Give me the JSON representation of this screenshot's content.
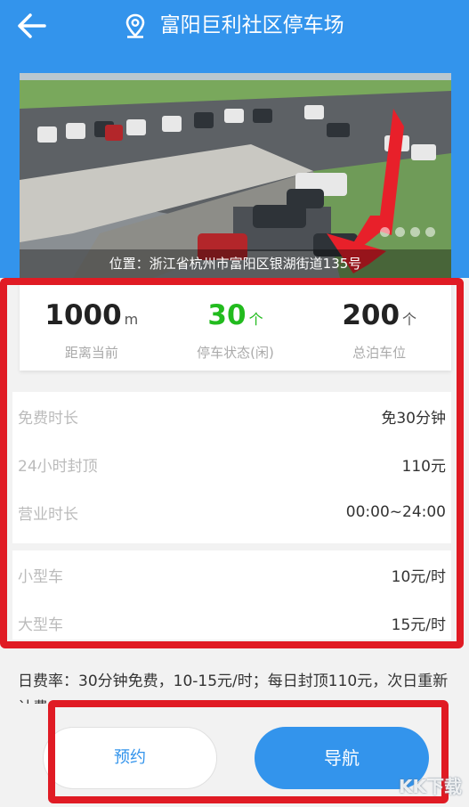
{
  "header": {
    "title": "富阳巨利社区停车场"
  },
  "photo": {
    "address": "位置：浙江省杭州市富阳区银湖街道135号"
  },
  "stats": [
    {
      "value": "1000",
      "unit": "m",
      "label": "距离当前"
    },
    {
      "value": "30",
      "unit": "个",
      "label": "停车状态(闲)"
    },
    {
      "value": "200",
      "unit": "个",
      "label": "总泊车位"
    }
  ],
  "info_a": [
    {
      "key": "免费时长",
      "value": "免30分钟"
    },
    {
      "key": "24小时封顶",
      "value": "110元"
    },
    {
      "key": "营业时长",
      "value": "00:00~24:00"
    }
  ],
  "info_b": [
    {
      "key": "小型车",
      "value": "10元/时"
    },
    {
      "key": "大型车",
      "value": "15元/时"
    }
  ],
  "fee_note": "日费率：30分钟免费，10-15元/时；每日封顶110元，次日重新计费",
  "buttons": {
    "reserve": "预约",
    "navigate": "导航"
  },
  "watermark": "KK下载",
  "colors": {
    "primary": "#3394ec",
    "free_green": "#22bb1e",
    "annotation_red": "#e01b24"
  }
}
